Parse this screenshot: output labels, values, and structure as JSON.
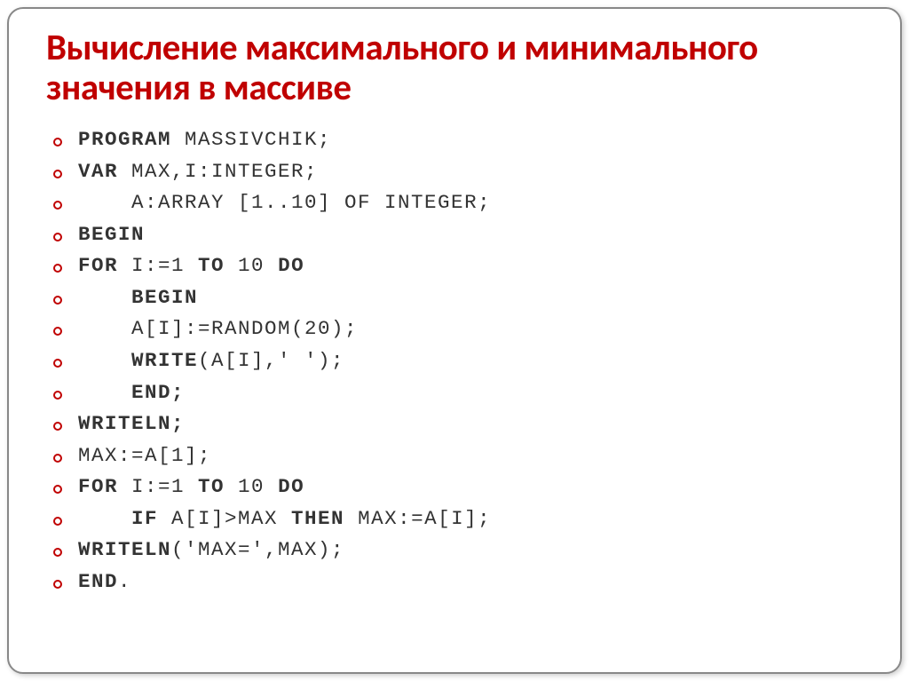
{
  "title": "Вычисление максимального и минимального значения в массиве",
  "lines": [
    {
      "segments": [
        {
          "t": "Program",
          "kw": true
        },
        {
          "t": " massivchik;",
          "kw": false
        }
      ]
    },
    {
      "segments": [
        {
          "t": "var",
          "kw": true
        },
        {
          "t": " max,i:integer;",
          "kw": false
        }
      ]
    },
    {
      "segments": [
        {
          "t": "    a:array [1..10] of integer;",
          "kw": false
        }
      ]
    },
    {
      "segments": [
        {
          "t": "BEGIN",
          "kw": true
        }
      ]
    },
    {
      "segments": [
        {
          "t": "for",
          "kw": true
        },
        {
          "t": " i:=1 ",
          "kw": false
        },
        {
          "t": "to",
          "kw": true
        },
        {
          "t": " 10 ",
          "kw": false
        },
        {
          "t": "do",
          "kw": true
        }
      ]
    },
    {
      "segments": [
        {
          "t": "    begin",
          "kw": true
        }
      ]
    },
    {
      "segments": [
        {
          "t": "    a[i]:=random(20);",
          "kw": false
        }
      ]
    },
    {
      "segments": [
        {
          "t": "    write",
          "kw": true
        },
        {
          "t": "(a[i],' ');",
          "kw": false
        }
      ]
    },
    {
      "segments": [
        {
          "t": "    end;",
          "kw": true
        }
      ]
    },
    {
      "segments": [
        {
          "t": "writeln;",
          "kw": true
        }
      ]
    },
    {
      "segments": [
        {
          "t": "max:=a[1];",
          "kw": false
        }
      ]
    },
    {
      "segments": [
        {
          "t": "for",
          "kw": true
        },
        {
          "t": " i:=1 ",
          "kw": false
        },
        {
          "t": "to",
          "kw": true
        },
        {
          "t": " 10 ",
          "kw": false
        },
        {
          "t": "do",
          "kw": true
        }
      ]
    },
    {
      "segments": [
        {
          "t": "    if",
          "kw": true
        },
        {
          "t": " a[i]>max ",
          "kw": false
        },
        {
          "t": "then",
          "kw": true
        },
        {
          "t": " max:=a[i];",
          "kw": false
        }
      ]
    },
    {
      "segments": [
        {
          "t": "writeln",
          "kw": true
        },
        {
          "t": "('max=',max);",
          "kw": false
        }
      ]
    },
    {
      "segments": [
        {
          "t": "END",
          "kw": true
        },
        {
          "t": ".",
          "kw": false
        }
      ]
    }
  ]
}
